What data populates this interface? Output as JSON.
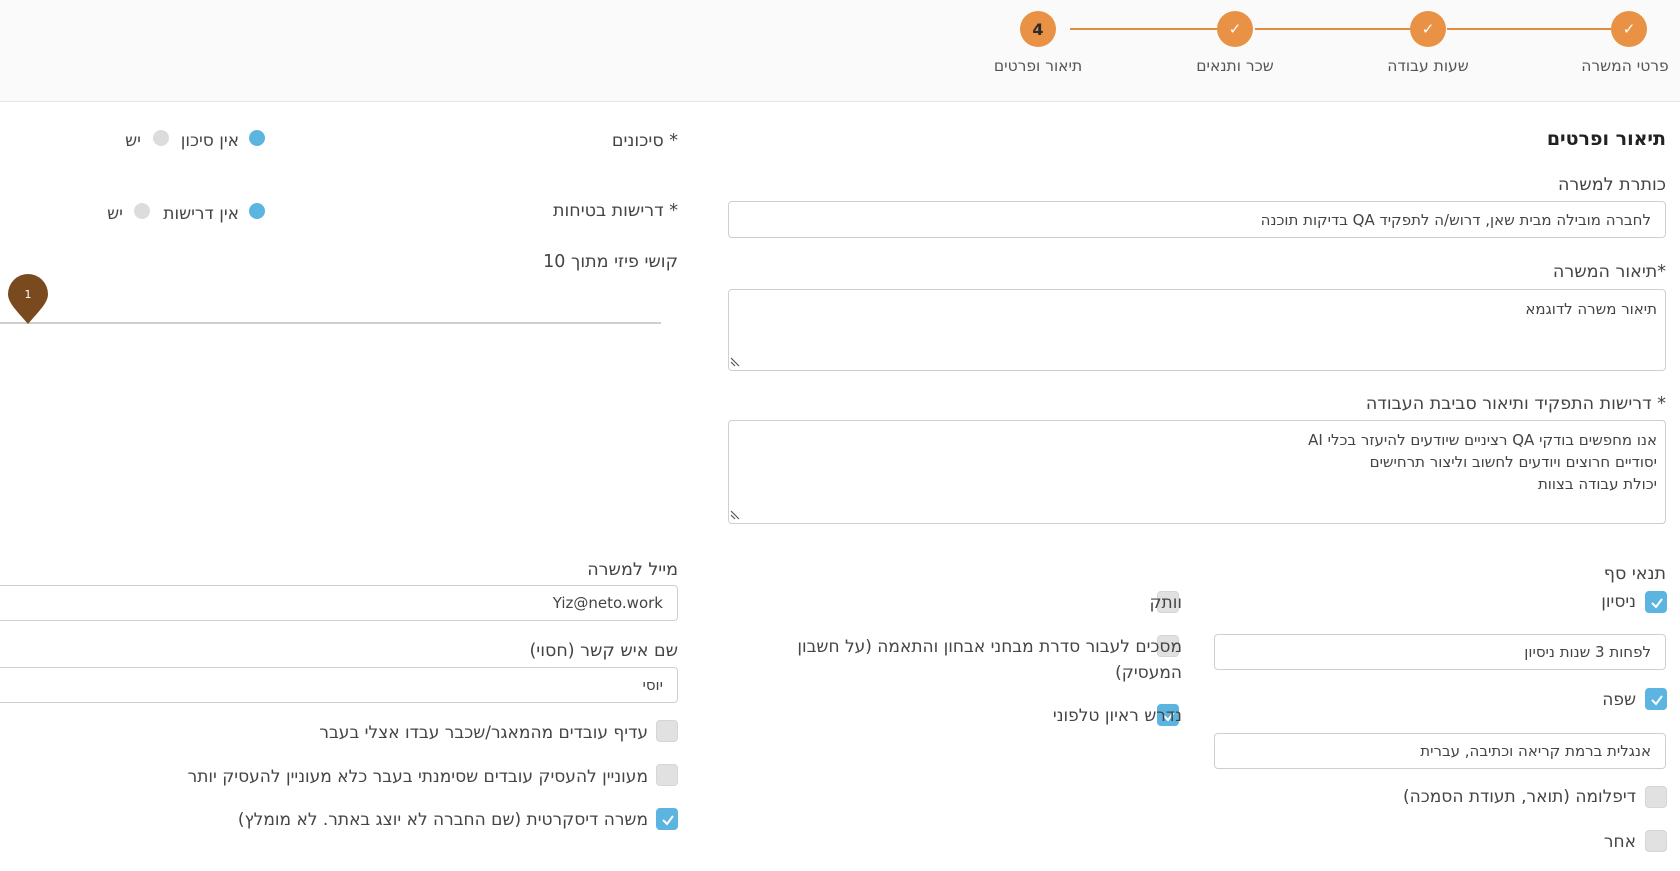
{
  "stepper": {
    "steps": [
      {
        "label": "פרטי המשרה",
        "mark": "✓"
      },
      {
        "label": "שעות עבודה",
        "mark": "✓"
      },
      {
        "label": "שכר ותנאים",
        "mark": "✓"
      },
      {
        "label": "תיאור ופרטים",
        "mark": "4"
      }
    ]
  },
  "section": {
    "title": "תיאור ופרטים"
  },
  "job_title": {
    "label": "כותרת למשרה",
    "value": "לחברה מובילה מבית שאן, דרוש/ה לתפקיד QA בדיקות תוכנה"
  },
  "job_description": {
    "label": "*תיאור המשרה",
    "value": "תיאור משרה לדוגמא"
  },
  "requirements": {
    "label": "* דרישות התפקיד ותיאור סביבת העבודה",
    "value": "אנו מחפשים בודקי QA רציניים שיודעים להיעזר בכלי AI\nיסודיים חרוצים ויודעים לחשוב וליצור תרחישים\nיכולת עבודה בצוות"
  },
  "threshold": {
    "label": "תנאי סף",
    "experience": {
      "label": "ניסיון",
      "checked": true,
      "value": "לפחות 3 שנות ניסיון"
    },
    "language": {
      "label": "שפה",
      "checked": true,
      "value": "אנגלית ברמת קריאה וכתיבה, עברית"
    },
    "diploma": {
      "label": "דיפלומה (תואר, תעודת הסמכה)",
      "checked": false
    },
    "other": {
      "label": "אחר",
      "checked": false
    },
    "seniority": {
      "label": "וותק",
      "checked": false
    },
    "tests": {
      "label_line1": "מסכים לעבור סדרת מבחני אבחון והתאמה (על חשבון",
      "label_line2": "המעסיק)",
      "checked": false
    },
    "phone_interview": {
      "label": "נדרש ראיון טלפוני",
      "checked": true
    }
  },
  "risks": {
    "label": "* סיכונים",
    "option_none": "אין סיכון",
    "option_yes": "יש"
  },
  "safety": {
    "label": "* דרישות בטיחות",
    "option_none": "אין דרישות",
    "option_yes": "יש"
  },
  "physical": {
    "label": "קושי פיזי מתוך 10",
    "value": "1"
  },
  "email": {
    "label": "מייל למשרה",
    "value": "Yiz@neto.work"
  },
  "contact": {
    "label": "שם איש קשר (חסוי)",
    "value": "יוסי"
  },
  "preferences": {
    "prefer_pool": {
      "label": "עדיף עובדים מהמאגר/שכבר עבדו אצלי בעבר",
      "checked": false
    },
    "no_rehire": {
      "label": "מעוניין להעסיק עובדים שסימנתי בעבר כלא מעוניין להעסיק יותר",
      "checked": false
    },
    "discreet": {
      "label": "משרה דיסקרטית (שם החברה לא יוצג באתר. לא מומלץ)",
      "checked": true
    }
  },
  "colors": {
    "accent": "#e99245",
    "check": "#5bb5e0",
    "slider_thumb": "#7a4a1f"
  }
}
